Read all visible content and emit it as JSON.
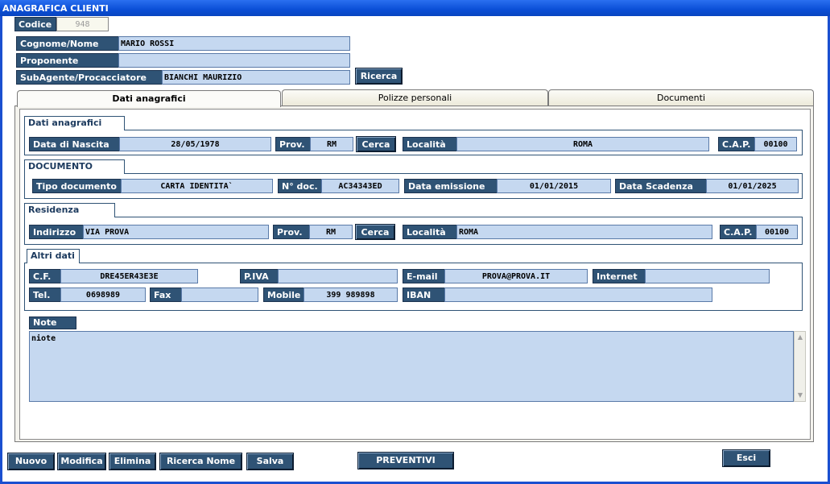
{
  "window": {
    "title": "ANAGRAFICA CLIENTI"
  },
  "header": {
    "codice_label": "Codice",
    "codice_value": "948",
    "cognome_label": "Cognome/Nome",
    "cognome_value": "MARIO ROSSI",
    "proponente_label": "Proponente",
    "proponente_value": "",
    "subagente_label": "SubAgente/Procacciatore",
    "subagente_value": "BIANCHI MAURIZIO",
    "ricerca_button": "Ricerca"
  },
  "tabs": [
    {
      "label": "Dati anagrafici",
      "active": true
    },
    {
      "label": "Polizze personali",
      "active": false
    },
    {
      "label": "Documenti",
      "active": false
    }
  ],
  "dati": {
    "title": "Dati anagrafici",
    "nascita_label": "Data di Nascita",
    "nascita_value": "28/05/1978",
    "prov_label": "Prov.",
    "prov_value": "RM",
    "cerca_button": "Cerca",
    "localita_label": "Località",
    "localita_value": "ROMA",
    "cap_label": "C.A.P.",
    "cap_value": "00100"
  },
  "documento": {
    "title": "DOCUMENTO",
    "tipo_label": "Tipo documento",
    "tipo_value": "CARTA IDENTITA`",
    "ndoc_label": "N° doc.",
    "ndoc_value": "AC34343ED",
    "emissione_label": "Data emissione",
    "emissione_value": "01/01/2015",
    "scadenza_label": "Data Scadenza",
    "scadenza_value": "01/01/2025"
  },
  "residenza": {
    "title": "Residenza",
    "indirizzo_label": "Indirizzo",
    "indirizzo_value": "VIA PROVA",
    "prov_label": "Prov.",
    "prov_value": "RM",
    "cerca_button": "Cerca",
    "localita_label": "Località",
    "localita_value": "ROMA",
    "cap_label": "C.A.P.",
    "cap_value": "00100"
  },
  "altri": {
    "title": "Altri dati",
    "cf_label": "C.F.",
    "cf_value": "DRE45ER43E3E",
    "piva_label": "P.IVA",
    "piva_value": "",
    "email_label": "E-mail",
    "email_value": "PROVA@PROVA.IT",
    "internet_label": "Internet",
    "internet_value": "",
    "tel_label": "Tel.",
    "tel_value": "0698989",
    "fax_label": "Fax",
    "fax_value": "",
    "mobile_label": "Mobile",
    "mobile_value": "399 989898",
    "iban_label": "IBAN",
    "iban_value": ""
  },
  "note": {
    "label": "Note",
    "value": "niote"
  },
  "toolbar": {
    "nuovo": "Nuovo",
    "modifica": "Modifica",
    "elimina": "Elimina",
    "ricerca_nome": "Ricerca Nome",
    "salva": "Salva",
    "preventivi": "PREVENTIVI",
    "esci": "Esci"
  }
}
